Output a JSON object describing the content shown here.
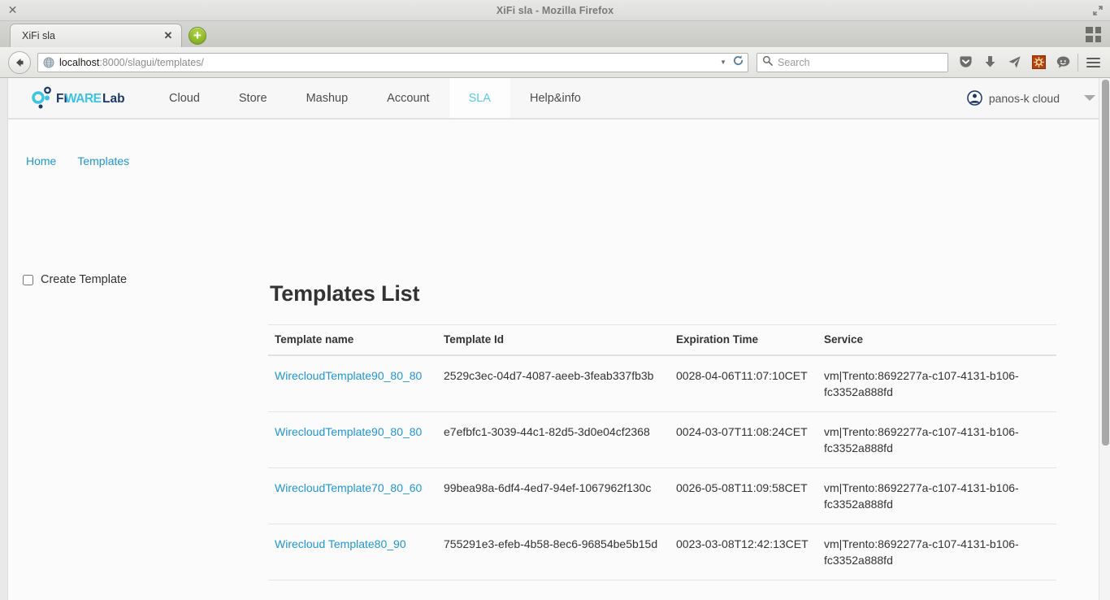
{
  "window": {
    "title": "XiFi sla - Mozilla Firefox",
    "close_icon": "close-icon",
    "restore_icon": "restore-icon"
  },
  "browser": {
    "tab": {
      "label": "XiFi sla",
      "close_icon": "tab-close-icon"
    },
    "new_tab_label": "+",
    "grid_icon": "grid-view-icon",
    "back_icon": "back-arrow-icon",
    "address": {
      "host": "localhost",
      "rest": ":8000/slagui/templates/",
      "globe_icon": "globe-icon",
      "dropdown_icon": "chevron-down-icon",
      "reload_icon": "reload-icon"
    },
    "search": {
      "placeholder": "Search",
      "icon": "search-icon"
    },
    "toolbar_icons": [
      {
        "name": "pocket-icon"
      },
      {
        "name": "download-icon"
      },
      {
        "name": "send-icon"
      },
      {
        "name": "addon-icon"
      },
      {
        "name": "chat-icon"
      },
      {
        "name": "hamburger-menu-icon"
      }
    ]
  },
  "site": {
    "brand": "FIWARE Lab",
    "nav": [
      {
        "label": "Cloud",
        "active": false
      },
      {
        "label": "Store",
        "active": false
      },
      {
        "label": "Mashup",
        "active": false
      },
      {
        "label": "Account",
        "active": false
      },
      {
        "label": "SLA",
        "active": true
      },
      {
        "label": "Help&info",
        "active": false
      }
    ],
    "user": {
      "name": "panos-k cloud",
      "avatar_icon": "user-avatar-icon",
      "caret_icon": "chevron-down-icon"
    }
  },
  "breadcrumb": [
    {
      "label": "Home"
    },
    {
      "label": "Templates"
    }
  ],
  "sidebar": {
    "create_template_label": "Create Template",
    "create_template_checked": false
  },
  "main": {
    "title": "Templates List",
    "columns": [
      "Template name",
      "Template Id",
      "Expiration Time",
      "Service"
    ],
    "rows": [
      {
        "name": "WirecloudTemplate90_80_80",
        "id": "2529c3ec-04d7-4087-aeeb-3feab337fb3b",
        "expiration": "0028-04-06T11:07:10CET",
        "service": "vm|Trento:8692277a-c107-4131-b106-fc3352a888fd"
      },
      {
        "name": "WirecloudTemplate90_80_80",
        "id": "e7efbfc1-3039-44c1-82d5-3d0e04cf2368",
        "expiration": "0024-03-07T11:08:24CET",
        "service": "vm|Trento:8692277a-c107-4131-b106-fc3352a888fd"
      },
      {
        "name": "WirecloudTemplate70_80_60",
        "id": "99bea98a-6df4-4ed7-94ef-1067962f130c",
        "expiration": "0026-05-08T11:09:58CET",
        "service": "vm|Trento:8692277a-c107-4131-b106-fc3352a888fd"
      },
      {
        "name": "Wirecloud Template80_90",
        "id": "755291e3-efeb-4b58-8ec6-96854be5b15d",
        "expiration": "0023-03-08T12:42:13CET",
        "service": "vm|Trento:8692277a-c107-4131-b106-fc3352a888fd"
      }
    ]
  },
  "colors": {
    "link": "#2196d4",
    "accent": "#5bc8e8",
    "brand_dark": "#1b3a6b",
    "brand_light": "#3fc3e0"
  }
}
